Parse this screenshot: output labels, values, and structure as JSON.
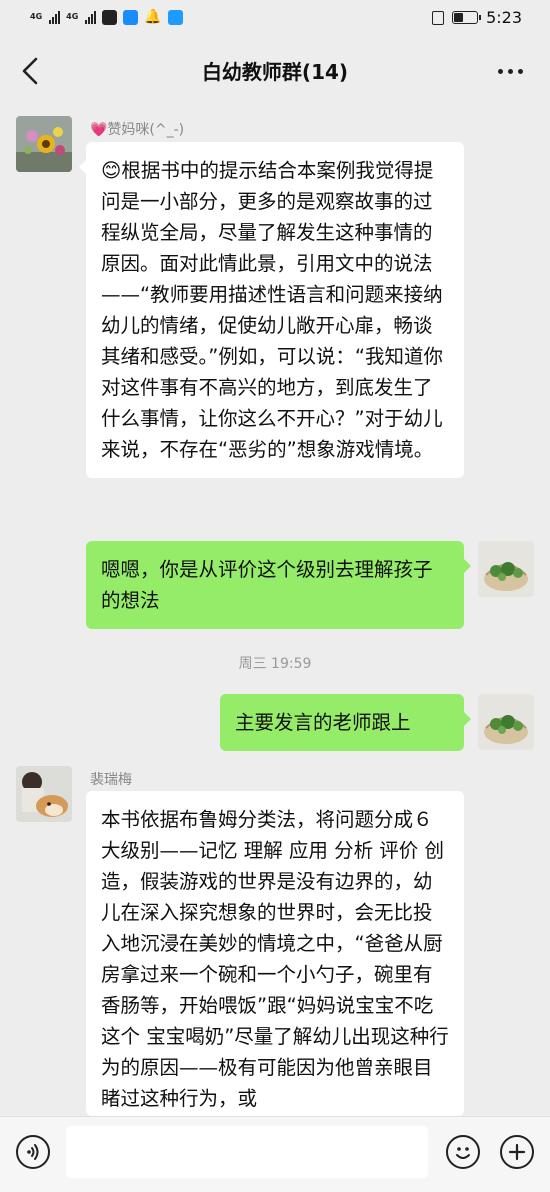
{
  "status_bar": {
    "signal1_label": "4G",
    "signal2_label": "4G",
    "time": "5:23"
  },
  "header": {
    "title": "白幼教师群(14)"
  },
  "messages": [
    {
      "sender": "💗赞妈咪(^_-)",
      "text": "😊根据书中的提示结合本案例我觉得提问是一小部分，更多的是观察故事的过程纵览全局，尽量了解发生这种事情的原因。面对此情此景，引用文中的说法——“教师要用描述性语言和问题来接纳幼儿的情绪，促使幼儿敞开心扉，畅谈其绪和感受。”例如，可以说：“我知道你对这件事有不高兴的地方，到底发生了什么事情，让你这么不开心？”对于幼儿来说，不存在“恶劣的”想象游戏情境。"
    },
    {
      "text": "嗯嗯，你是从评价这个级别去理解孩子的想法"
    },
    {
      "timestamp": "周三 19:59"
    },
    {
      "text": "主要发言的老师跟上"
    },
    {
      "sender": "裴瑞梅",
      "text": "本书依据布鲁姆分类法，将问题分成６大级别——记忆 理解 应用 分析 评价 创造，假装游戏的世界是没有边界的，幼儿在深入探究想象的世界时，会无比投入地沉浸在美妙的情境之中，“爸爸从厨房拿过来一个碗和一个小勺子，碗里有香肠等，开始喂饭”跟“妈妈说宝宝不吃这个 宝宝喝奶”尽量了解幼儿出现这种行为的原因——极有可能因为他曾亲眼目睹过这种行为，或"
    }
  ],
  "icons": {
    "back": "back-arrow-icon",
    "more": "more-icon",
    "voice": "voice-icon",
    "emoji": "emoji-icon",
    "add": "plus-icon"
  },
  "colors": {
    "background": "#ededed",
    "outgoing_bubble": "#95ec69",
    "incoming_bubble": "#ffffff"
  }
}
